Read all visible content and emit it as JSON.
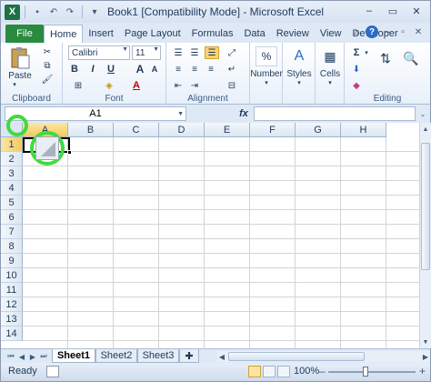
{
  "window": {
    "title": "Book1  [Compatibility Mode]  -  Microsoft Excel",
    "minimize": "–",
    "maximize": "▭",
    "close": "✕"
  },
  "ribbon_tabs": [
    "File",
    "Home",
    "Insert",
    "Page Layout",
    "Formulas",
    "Data",
    "Review",
    "View",
    "Developer"
  ],
  "active_tab": "Home",
  "ribbon": {
    "clipboard": {
      "label": "Clipboard",
      "paste": "Paste"
    },
    "font": {
      "label": "Font",
      "font_name": "Calibri",
      "font_size": "11",
      "bold": "B",
      "italic": "I",
      "underline": "U",
      "grow": "A",
      "shrink": "A"
    },
    "alignment": {
      "label": "Alignment"
    },
    "number": {
      "label": "Number",
      "percent": "%"
    },
    "styles": {
      "label": "Styles"
    },
    "cells": {
      "label": "Cells"
    },
    "editing": {
      "label": "Editing",
      "sum": "Σ"
    }
  },
  "formula_bar": {
    "name_box": "A1",
    "fx": "fx",
    "formula": ""
  },
  "grid": {
    "columns": [
      "A",
      "B",
      "C",
      "D",
      "E",
      "F",
      "G",
      "H"
    ],
    "rows": [
      "1",
      "2",
      "3",
      "4",
      "5",
      "6",
      "7",
      "8",
      "9",
      "10",
      "11",
      "12",
      "13",
      "14"
    ],
    "selected_cell": "A1"
  },
  "sheets": [
    "Sheet1",
    "Sheet2",
    "Sheet3"
  ],
  "active_sheet": "Sheet1",
  "status": {
    "ready": "Ready",
    "zoom": "100%",
    "minus": "–",
    "plus": "+"
  },
  "colors": {
    "file_tab": "#2a8a3f",
    "highlight": "#3edc3e",
    "selected_header": "#f5c95d"
  }
}
